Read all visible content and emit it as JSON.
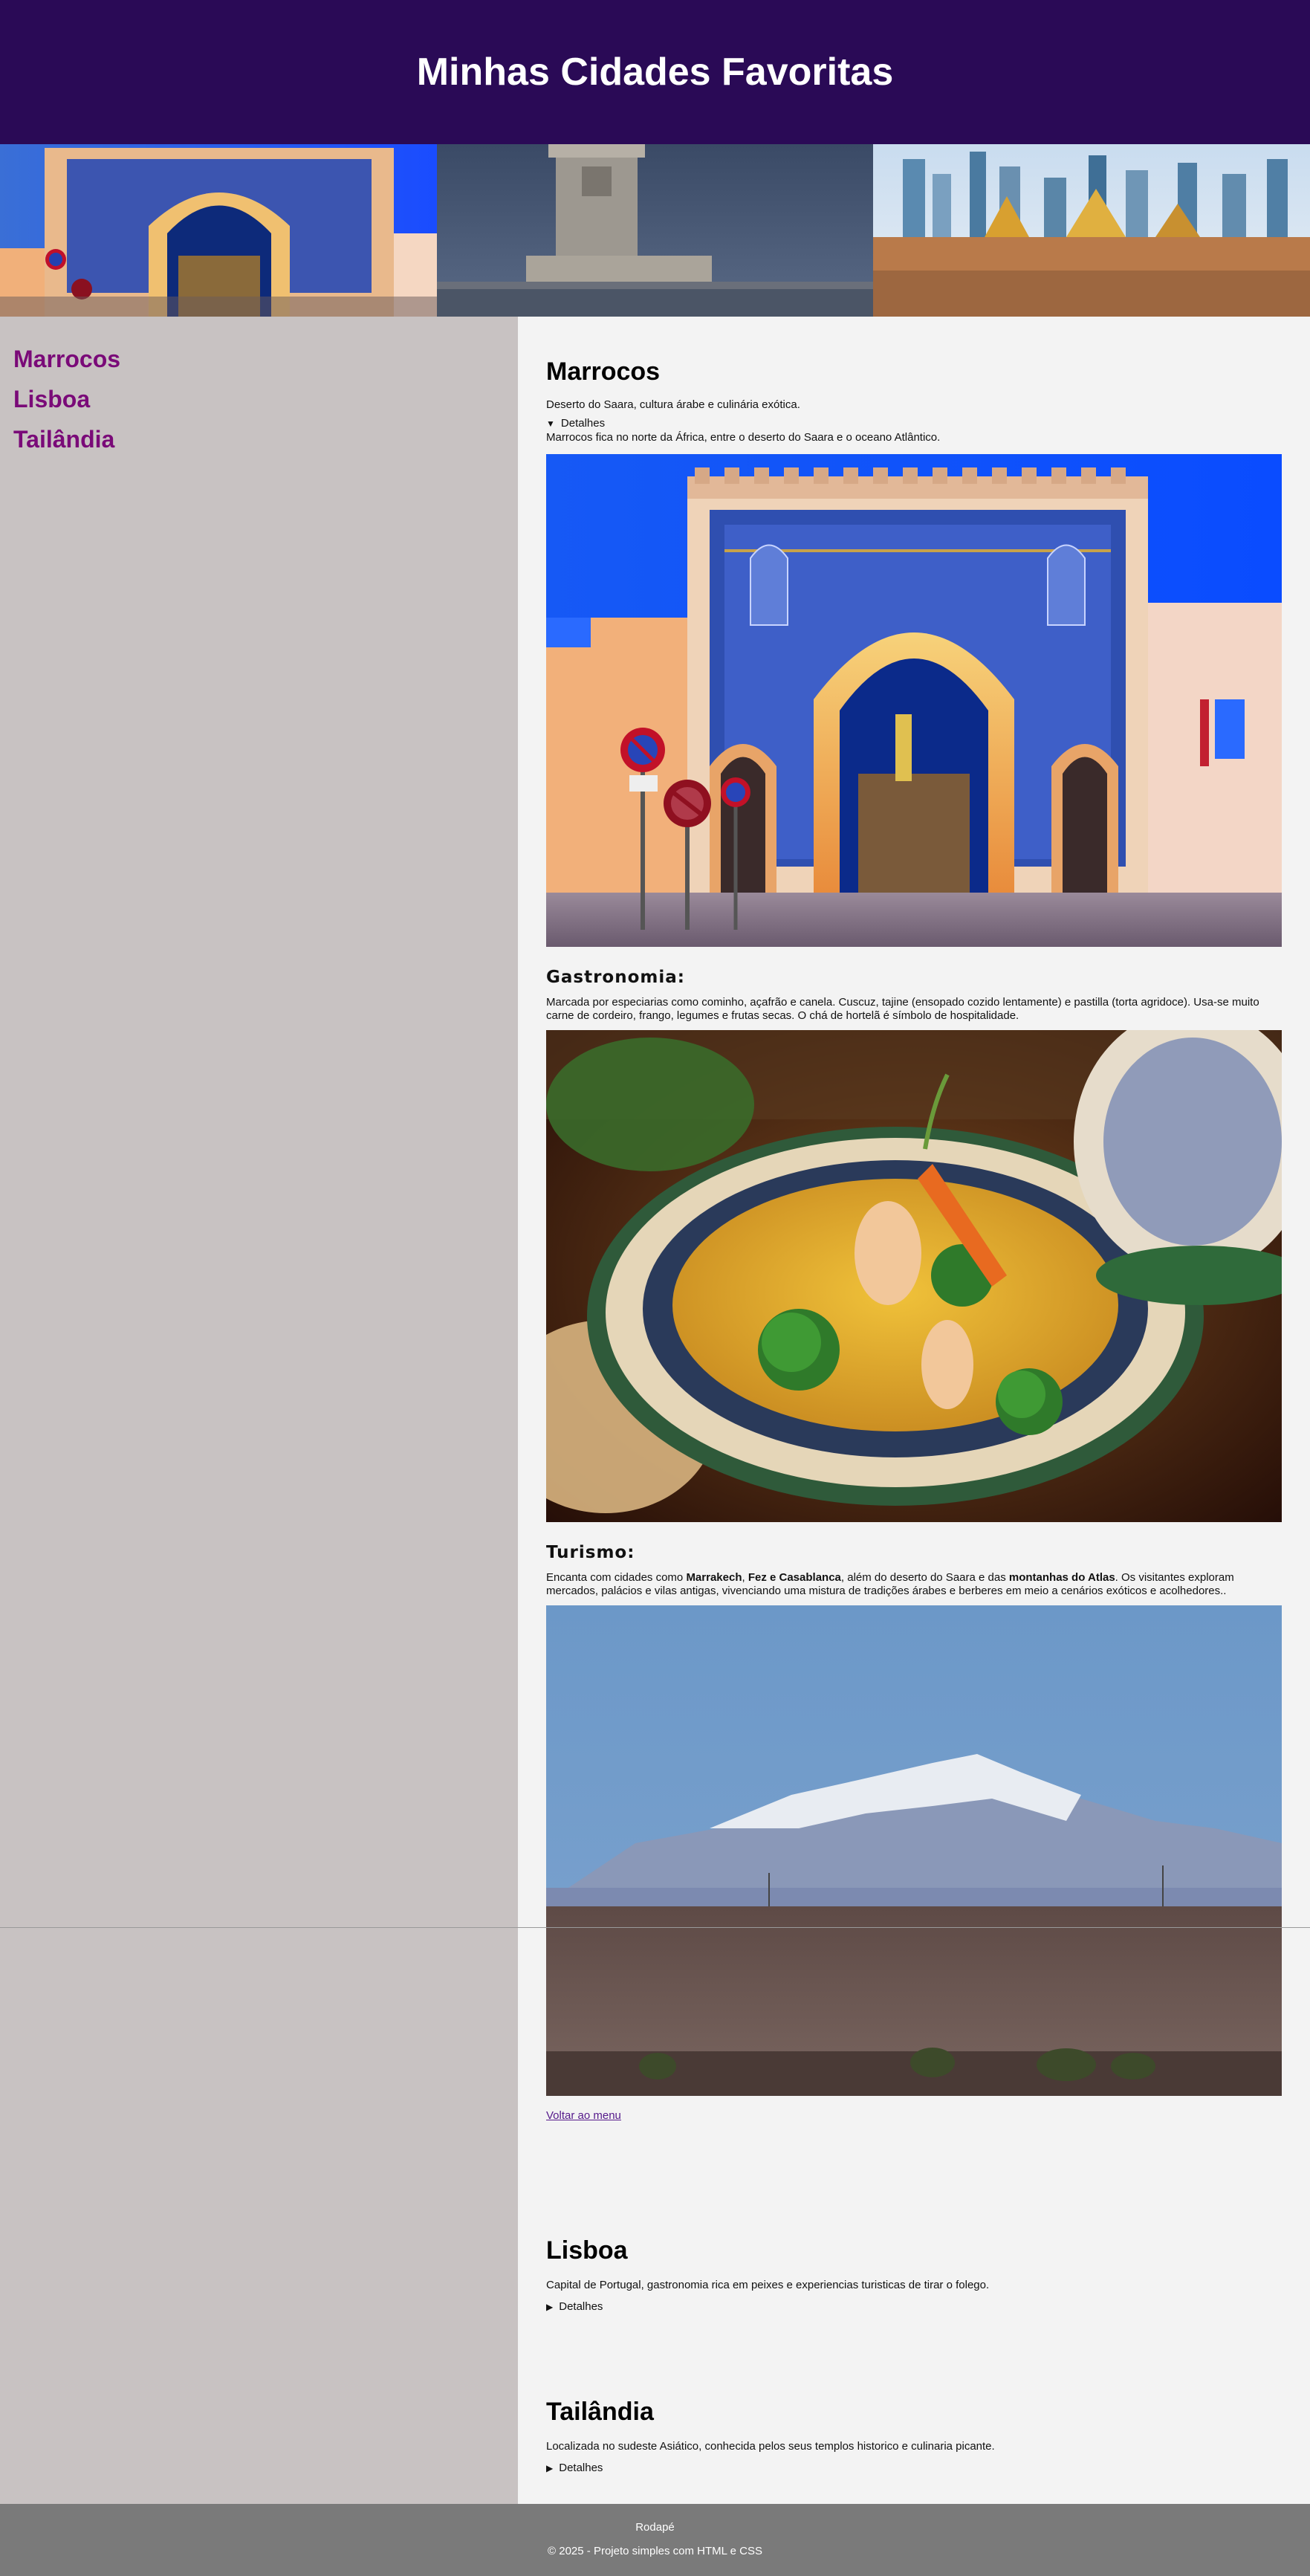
{
  "header": {
    "title": "Minhas Cidades Favoritas"
  },
  "banner": {
    "images": [
      {
        "name": "Marrocos"
      },
      {
        "name": "Lisboa"
      },
      {
        "name": "Tailândia"
      }
    ]
  },
  "sidebar": {
    "items": [
      {
        "label": "Marrocos"
      },
      {
        "label": "Lisboa"
      },
      {
        "label": "Tailândia"
      }
    ]
  },
  "sections": {
    "marrocos": {
      "title": "Marrocos",
      "lead": "Deserto do Saara, cultura árabe e culinária exótica.",
      "details_label": "Detalhes",
      "details_text": "Marrocos fica no norte da África, entre o deserto do Saara e o oceano Atlântico.",
      "gastronomia_title": "Gastronomia:",
      "gastronomia_text": "Marcada por especiarias como cominho, açafrão e canela. Cuscuz, tajine (ensopado cozido lentamente) e pastilla (torta agridoce). Usa-se muito carne de cordeiro, frango, legumes e frutas secas. O chá de hortelã é símbolo de hospitalidade.",
      "turismo_title": "Turismo:",
      "turismo_text": {
        "p1": "Encanta com cidades como ",
        "b1": "Marrakech",
        "p2": ", ",
        "b2": "Fez e Casablanca",
        "p3": ", além do deserto do Saara e das ",
        "b3": "montanhas do Atlas",
        "p4": ". Os visitantes exploram mercados, palácios e vilas antigas, vivenciando uma mistura de tradições árabes e berberes em meio a cenários exóticos e acolhedores.."
      },
      "back_link": "Voltar ao menu"
    },
    "lisboa": {
      "title": "Lisboa",
      "lead": "Capital de Portugal, gastronomia rica em peixes e experiencias turisticas de tirar o folego.",
      "details_label": "Detalhes"
    },
    "tailandia": {
      "title": "Tailândia",
      "lead": "Localizada no sudeste Asiático, conhecida pelos seus templos historico e culinaria picante.",
      "details_label": "Detalhes"
    }
  },
  "footer": {
    "title": "Rodapé",
    "copyright": "© 2025 - Projeto simples com HTML e CSS"
  }
}
